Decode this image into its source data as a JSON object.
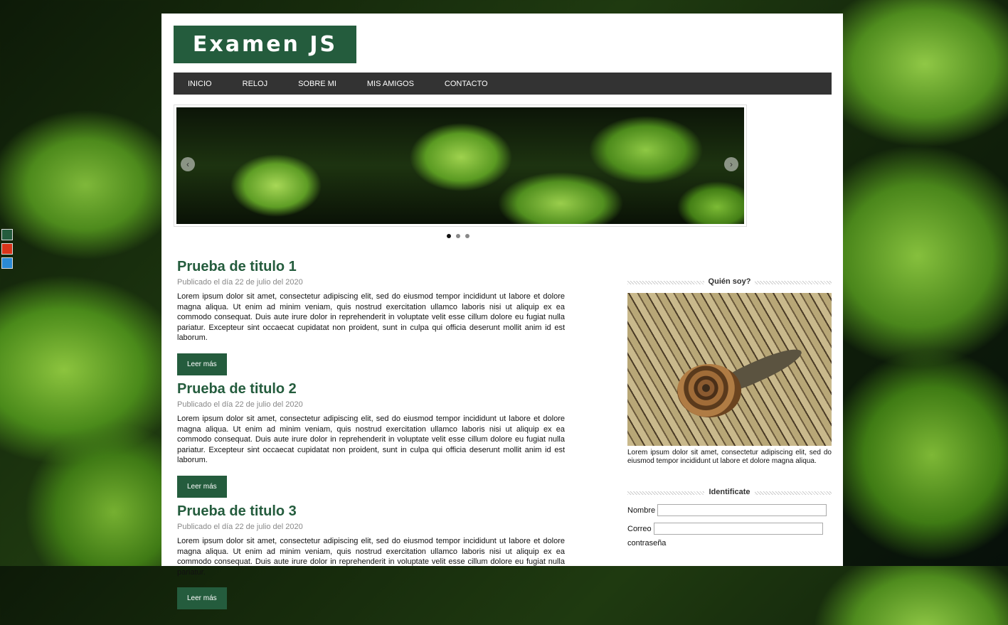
{
  "site": {
    "logo": "Examen JS",
    "theme_colors": [
      "#245c3d",
      "#d9341a",
      "#2a8ad4"
    ]
  },
  "nav": {
    "items": [
      "INICIO",
      "RELOJ",
      "SOBRE MI",
      "MIS AMIGOS",
      "CONTACTO"
    ]
  },
  "slider": {
    "prev_icon": "chevron-left-icon",
    "next_icon": "chevron-right-icon",
    "prev_glyph": "‹",
    "next_glyph": "›",
    "dots": 3,
    "active_dot": 1
  },
  "posts": [
    {
      "title": "Prueba de titulo 1",
      "meta": "Publicado el día 22 de julio del 2020",
      "body": "Lorem ipsum dolor sit amet, consectetur adipiscing elit, sed do eiusmod tempor incididunt ut labore et dolore magna aliqua. Ut enim ad minim veniam, quis nostrud exercitation ullamco laboris nisi ut aliquip ex ea commodo consequat. Duis aute irure dolor in reprehenderit in voluptate velit esse cillum dolore eu fugiat nulla pariatur. Excepteur sint occaecat cupidatat non proident, sunt in culpa qui officia deserunt mollit anim id est laborum.",
      "button": "Leer más"
    },
    {
      "title": "Prueba de titulo 2",
      "meta": "Publicado el día 22 de julio del 2020",
      "body": "Lorem ipsum dolor sit amet, consectetur adipiscing elit, sed do eiusmod tempor incididunt ut labore et dolore magna aliqua. Ut enim ad minim veniam, quis nostrud exercitation ullamco laboris nisi ut aliquip ex ea commodo consequat. Duis aute irure dolor in reprehenderit in voluptate velit esse cillum dolore eu fugiat nulla pariatur. Excepteur sint occaecat cupidatat non proident, sunt in culpa qui officia deserunt mollit anim id est laborum.",
      "button": "Leer más"
    },
    {
      "title": "Prueba de titulo 3",
      "meta": "Publicado el día 22 de julio del 2020",
      "body": "Lorem ipsum dolor sit amet, consectetur adipiscing elit, sed do eiusmod tempor incididunt ut labore et dolore magna aliqua. Ut enim ad minim veniam, quis nostrud exercitation ullamco laboris nisi ut aliquip ex ea commodo consequat. Duis aute irure dolor in reprehenderit in voluptate velit esse cillum dolore eu fugiat nulla pariatur.",
      "button": "Leer más"
    }
  ],
  "sidebar": {
    "about_title": "Quién soy?",
    "about_text": "Lorem ipsum dolor sit amet, consectetur adipiscing elit, sed do eiusmod tempor incididunt ut labore et dolore magna aliqua.",
    "login_title": "Identificate",
    "fields": {
      "name_label": "Nombre",
      "email_label": "Correo",
      "password_label": "contraseña"
    }
  }
}
